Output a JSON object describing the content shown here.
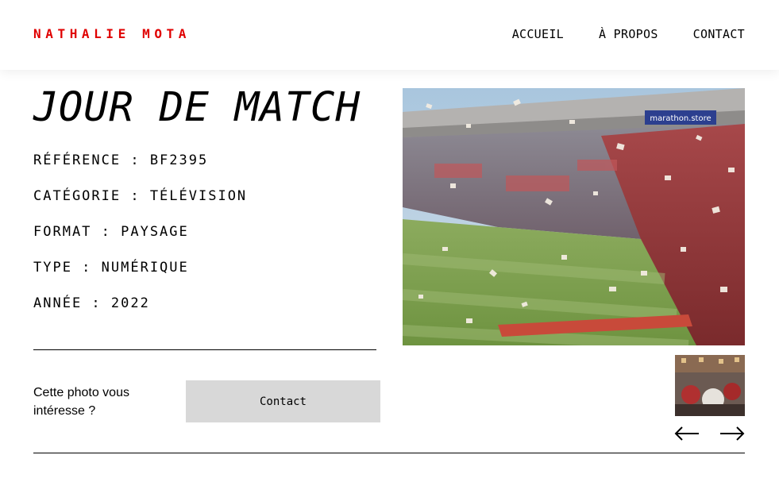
{
  "header": {
    "logo": "NATHALIE MOTA",
    "nav": [
      {
        "label": "ACCUEIL"
      },
      {
        "label": "À PROPOS"
      },
      {
        "label": "CONTACT"
      }
    ]
  },
  "photo": {
    "title": "JOUR DE MATCH",
    "details": [
      {
        "text": "RÉFÉRENCE : BF2395"
      },
      {
        "text": "CATÉGORIE : TÉLÉVISION"
      },
      {
        "text": "FORMAT : PAYSAGE"
      },
      {
        "text": "TYPE : NUMÉRIQUE"
      },
      {
        "text": "ANNÉE : 2022"
      }
    ],
    "image_banner_text": "marathon.store"
  },
  "cta": {
    "question": "Cette photo vous intéresse ?",
    "button_label": "Contact"
  },
  "navigation": {
    "prev_icon": "arrow-left-icon",
    "next_icon": "arrow-right-icon"
  },
  "colors": {
    "brand_red": "#E00000",
    "button_bg": "#d8d8d8"
  }
}
